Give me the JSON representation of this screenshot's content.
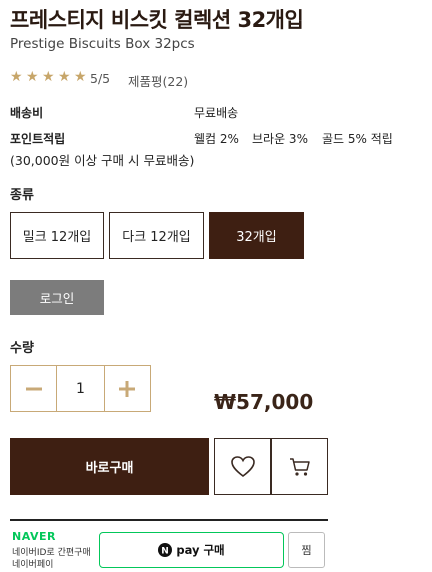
{
  "product": {
    "title": "프레스티지 비스킷 컬렉션 32개입",
    "subtitle": "Prestige Biscuits Box 32pcs",
    "rating_stars": 5,
    "rating_text": "5/5",
    "review_text": "제품평(22)"
  },
  "info": {
    "shipping_label": "배송비",
    "shipping_value": "무료배송",
    "points_label": "포인트적립",
    "points_welcome": "웰컴 2%",
    "points_brown": "브라운 3%",
    "points_gold": "골드 5% 적립",
    "free_shipping_note": "(30,000원 이상 구매 시 무료배송)"
  },
  "options": {
    "label": "종류",
    "items": [
      {
        "label": "밀크 12개입",
        "selected": false
      },
      {
        "label": "다크 12개입",
        "selected": false
      },
      {
        "label": "32개입",
        "selected": true
      }
    ]
  },
  "login_label": "로그인",
  "quantity": {
    "label": "수량",
    "value": "1",
    "minus_icon": "minus-icon",
    "plus_icon": "plus-icon"
  },
  "price": "₩57,000",
  "actions": {
    "buy_label": "바로구매",
    "wish_icon": "heart-icon",
    "cart_icon": "cart-icon"
  },
  "naverpay": {
    "brand": "NAVER",
    "line1": "네이버ID로 간편구매",
    "line2": "네이버페이",
    "pay_label": "pay 구매",
    "jjim_label": "찜"
  },
  "colors": {
    "brand_brown": "#3e1f12",
    "gold": "#c8a977",
    "naver_green": "#03c75a",
    "gray_button": "#7c7c7c"
  }
}
